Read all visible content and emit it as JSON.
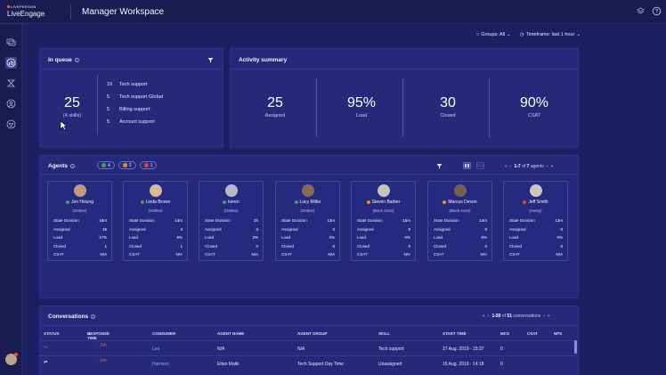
{
  "brand": {
    "small": "LIVEPERSON",
    "main": "LiveEngage"
  },
  "app_title": "Manager Workspace",
  "filters": {
    "groups": "Groups: All",
    "timeframe": "Timeframe: last 1 hour"
  },
  "in_queue": {
    "title": "In queue",
    "total": "25",
    "total_sub": "(4 skills)",
    "skills": [
      {
        "count": "10",
        "name": "Tech support"
      },
      {
        "count": "5",
        "name": "Tech support Global"
      },
      {
        "count": "5",
        "name": "Billing support"
      },
      {
        "count": "5",
        "name": "Account support"
      }
    ]
  },
  "activity": {
    "title": "Activity summary",
    "items": [
      {
        "value": "25",
        "label": "Assigned"
      },
      {
        "value": "95%",
        "label": "Load"
      },
      {
        "value": "30",
        "label": "Closed"
      },
      {
        "value": "90%",
        "label": "CSAT"
      }
    ]
  },
  "agents_panel": {
    "title": "Agents",
    "chips": [
      {
        "count": "4",
        "color": "#3fa64a"
      },
      {
        "count": "2",
        "color": "#f08a24"
      },
      {
        "count": "1",
        "color": "#e0453a"
      }
    ],
    "pager": {
      "range": "1-7",
      "of": "of",
      "total": "7",
      "unit": "agents"
    }
  },
  "stat_labels": [
    "State Duration",
    "Assigned",
    "Load",
    "Closed",
    "CSAT"
  ],
  "agents": [
    {
      "name": "Jen Hsiung",
      "status": "(Online)",
      "dot": "#3fa64a",
      "photo": "#c49a7a",
      "stats": [
        "16m",
        "16",
        "17%",
        "1",
        "N/A"
      ]
    },
    {
      "name": "Linda Brown",
      "status": "(Online)",
      "dot": "#3fa64a",
      "photo": "#d9b79a",
      "stats": [
        "14m",
        "3",
        "6%",
        "1",
        "N/A"
      ]
    },
    {
      "name": "keren",
      "status": "(Online)",
      "dot": "#3fa64a",
      "photo": "#b8b8c4",
      "stats": [
        "2h",
        "3",
        "2%",
        "0",
        "N/A"
      ]
    },
    {
      "name": "Lucy Miller",
      "status": "(Online)",
      "dot": "#3fa64a",
      "photo": "#8a6a52",
      "stats": [
        "13m",
        "3",
        "2%",
        "0",
        "N/A"
      ]
    },
    {
      "name": "Steven Barber",
      "status": "(Back soon)",
      "dot": "#f08a24",
      "photo": "#c7c2bc",
      "stats": [
        "15m",
        "0",
        "0%",
        "0",
        "N/A"
      ]
    },
    {
      "name": "Marcus Devon",
      "status": "(Back soon)",
      "dot": "#f08a24",
      "photo": "#7a5e4e",
      "stats": [
        "14m",
        "0",
        "0%",
        "0",
        "N/A"
      ]
    },
    {
      "name": "Jeff Smith",
      "status": "(Away)",
      "dot": "#e0453a",
      "photo": "#cfc6bb",
      "stats": [
        "13m",
        "0",
        "0%",
        "0",
        "N/A"
      ]
    }
  ],
  "conversations": {
    "title": "Conversations",
    "pager": {
      "range": "1-50",
      "of": "of",
      "total": "51",
      "unit": "conversations"
    },
    "headers": [
      "STATUS",
      "RESPONSE TIME",
      "CONSUMER",
      "AGENT NAME",
      "AGENT GROUP",
      "SKILL",
      "START TIME",
      "MCS",
      "CSAT",
      "NPS"
    ],
    "rows": [
      {
        "response": "-2m",
        "consumer": "Leo",
        "agent": "N/A",
        "group": "N/A",
        "skill": "Tech support",
        "start": "27 Aug. 2019 - 15:37",
        "mcs": "0"
      },
      {
        "response": "-2m",
        "consumer": "Harrison",
        "agent": "Eitan Malki",
        "group": "Tech Support Day Time",
        "skill": "Unassigned",
        "start": "15 Aug. 2019 - 14:18",
        "mcs": "0"
      }
    ]
  }
}
